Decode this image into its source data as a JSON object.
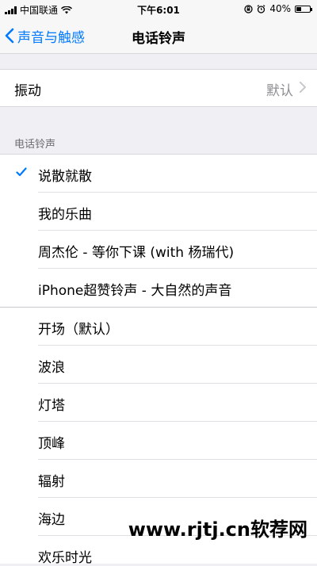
{
  "status_bar": {
    "carrier": "中国联通",
    "time": "下午6:01",
    "battery": "40%",
    "battery_level": 0.4
  },
  "nav": {
    "back_label": "声音与触感",
    "title": "电话铃声"
  },
  "vibration": {
    "label": "振动",
    "value": "默认"
  },
  "ringtones": {
    "section_header": "电话铃声",
    "custom": [
      {
        "label": "说散就散",
        "checked": true
      },
      {
        "label": "我的乐曲",
        "checked": false
      },
      {
        "label": "周杰伦 - 等你下课 (with 杨瑞代)",
        "checked": false
      },
      {
        "label": "iPhone超赞铃声 - 大自然的声音",
        "checked": false
      }
    ],
    "builtin": [
      {
        "label": "开场（默认）"
      },
      {
        "label": "波浪"
      },
      {
        "label": "灯塔"
      },
      {
        "label": "顶峰"
      },
      {
        "label": "辐射"
      },
      {
        "label": "海边"
      },
      {
        "label": "欢乐时光"
      }
    ]
  },
  "watermark": "www.rjtj.cn软荐网",
  "colors": {
    "accent": "#007aff",
    "background": "#efeff4"
  }
}
